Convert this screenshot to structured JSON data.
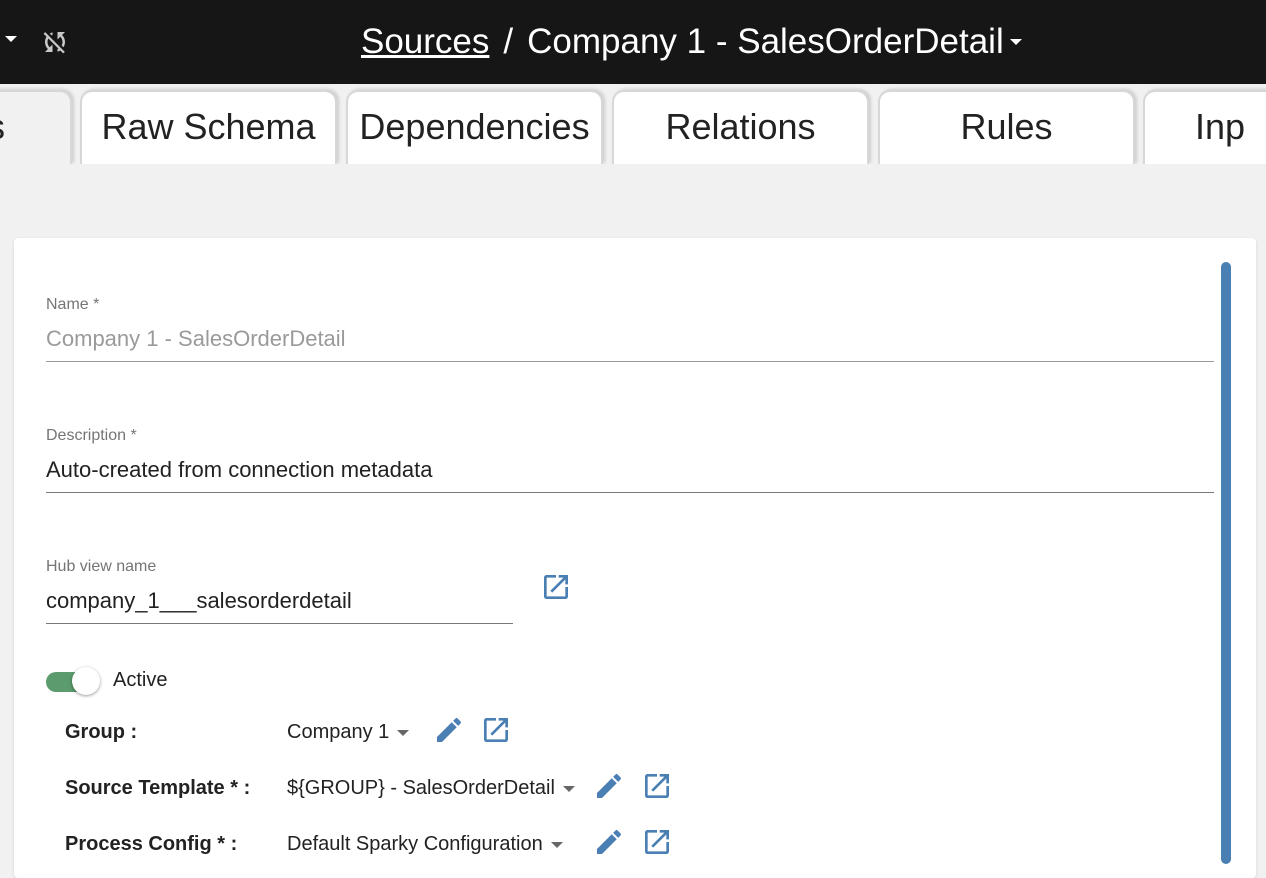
{
  "breadcrumb": {
    "root": "Sources",
    "separator": "/",
    "current": "Company 1 - SalesOrderDetail"
  },
  "tabs": [
    {
      "label": "s",
      "active": true
    },
    {
      "label": "Raw Schema"
    },
    {
      "label": "Dependencies"
    },
    {
      "label": "Relations"
    },
    {
      "label": "Rules"
    },
    {
      "label": "Inp"
    }
  ],
  "form": {
    "name_label": "Name *",
    "name_value": "Company 1 - SalesOrderDetail",
    "description_label": "Description *",
    "description_value": "Auto-created from connection metadata",
    "hub_view_label": "Hub view name",
    "hub_view_value": "company_1___salesorderdetail",
    "active_label": "Active",
    "active": true,
    "group_label": "Group :",
    "group_value": "Company 1",
    "source_template_label": "Source Template * :",
    "source_template_value": "${GROUP} - SalesOrderDetail",
    "process_config_label": "Process Config * :",
    "process_config_value": "Default Sparky Configuration"
  },
  "colors": {
    "header_bg": "#161616",
    "accent": "#4a7fb4",
    "toggle_on": "#5b9b6d"
  }
}
